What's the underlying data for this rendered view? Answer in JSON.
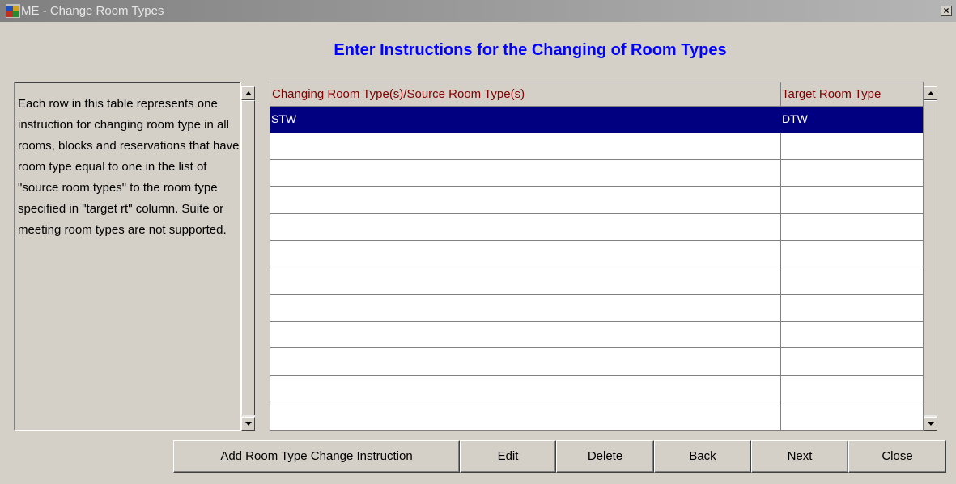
{
  "window": {
    "title": "ME - Change Room Types",
    "close_label": "×"
  },
  "heading": "Enter Instructions for the Changing of Room Types",
  "description": "Each row in this table represents one instruction for changing room type in all rooms, blocks and reservations that have room type equal to one in the list of \"source room types\" to the room type specified in \"target rt\" column. Suite or meeting room types are not supported.",
  "grid": {
    "headers": [
      "Changing Room Type(s)/Source Room Type(s)",
      "Target Room Type"
    ],
    "rows": [
      {
        "source": "STW",
        "target": "DTW"
      },
      {
        "source": "",
        "target": ""
      },
      {
        "source": "",
        "target": ""
      },
      {
        "source": "",
        "target": ""
      },
      {
        "source": "",
        "target": ""
      },
      {
        "source": "",
        "target": ""
      },
      {
        "source": "",
        "target": ""
      },
      {
        "source": "",
        "target": ""
      },
      {
        "source": "",
        "target": ""
      },
      {
        "source": "",
        "target": ""
      },
      {
        "source": "",
        "target": ""
      },
      {
        "source": "",
        "target": ""
      }
    ],
    "selected_row": 0
  },
  "buttons": {
    "add": {
      "mnemonic": "A",
      "rest": "dd Room Type Change Instruction"
    },
    "edit": {
      "mnemonic": "E",
      "rest": "dit"
    },
    "delete": {
      "mnemonic": "D",
      "rest": "elete"
    },
    "back": {
      "mnemonic": "B",
      "rest": "ack"
    },
    "next": {
      "mnemonic": "N",
      "rest": "ext"
    },
    "close": {
      "mnemonic": "C",
      "rest": "lose"
    }
  }
}
